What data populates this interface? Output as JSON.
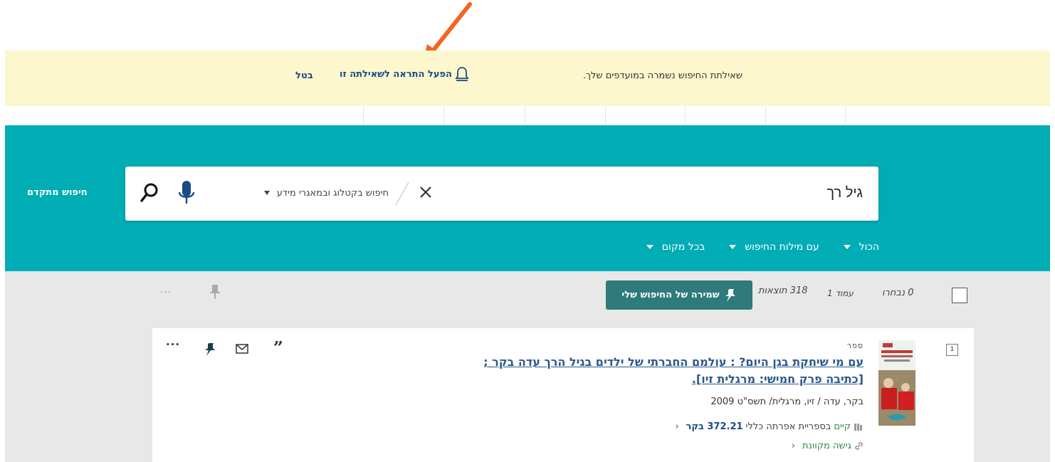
{
  "notification": {
    "message": "שאילתת החיפוש נשמרה במועדפים שלך.",
    "alert_label": "הפעל התראה לשאילתה זו",
    "cancel_label": "בטל"
  },
  "search": {
    "query": "גיל רך",
    "scope_label": "חיפוש בקטלוג ובמאגרי מידע",
    "advanced_label": "חיפוש מתקדם"
  },
  "filters": [
    {
      "label": "הכול"
    },
    {
      "label": "עם מילות החיפוש"
    },
    {
      "label": "בכל מקום"
    }
  ],
  "results_bar": {
    "selected": "0 נבחרו",
    "page": "עמוד 1",
    "count": "318 תוצאות",
    "save_search_label": "שמירה של החיפוש שלי",
    "more": "···"
  },
  "result": {
    "rank": "1",
    "type": "ספר",
    "title": "עם מי שיחקת בגן היום? : עולמם החברתי של ילדים בגיל הרך עדה בקר ; [כתיבה פרק חמישי: מרגלית זיו].",
    "authors": "בקר, עדה / זיו, מרגלית/ תשס\"ט 2009",
    "availability_status": "קיים",
    "availability_location": "בספריית אפרתה  כללי",
    "call_number": "372.21 בקר",
    "online_access": "גישה מקוונת",
    "actions_more": "···",
    "quote_mark": "”"
  },
  "colors": {
    "notice_bg": "#fcf7cd",
    "teal": "#00adb5",
    "save_btn": "#2f7a7a",
    "link": "#2b5a8c",
    "available": "#2f8a3b",
    "arrow": "#f26522"
  }
}
